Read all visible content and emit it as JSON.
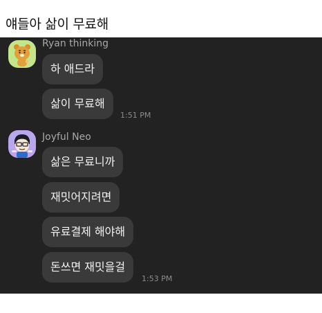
{
  "post": {
    "title": "얘들아 삶이 무료해"
  },
  "chat": {
    "groups": [
      {
        "sender": "Ryan thinking",
        "avatar_icon": "ryan-avatar-icon",
        "messages": [
          "하 애드라",
          "삶이 무료해"
        ],
        "time": "1:51 PM"
      },
      {
        "sender": "Joyful Neo",
        "avatar_icon": "neo-avatar-icon",
        "messages": [
          "삶은 무료니까",
          "재밋어지려면",
          "유료결제 해야해",
          "돈쓰면 재밋을걸"
        ],
        "time": "1:53 PM"
      }
    ]
  },
  "colors": {
    "chat_background": "#222222",
    "bubble": "#3a3a3a",
    "text": "#f2f2f2",
    "sender_text": "#a9a9a9"
  }
}
